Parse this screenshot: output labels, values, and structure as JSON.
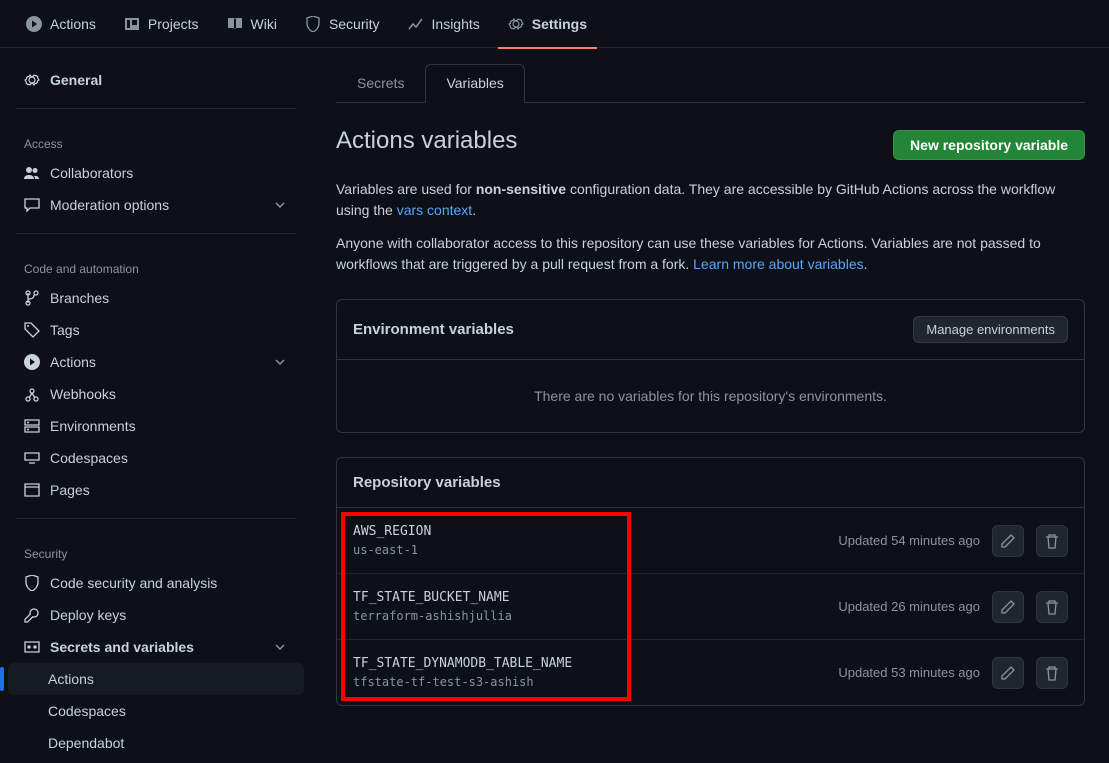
{
  "topnav": [
    {
      "icon": "play",
      "label": "Actions"
    },
    {
      "icon": "project",
      "label": "Projects"
    },
    {
      "icon": "book",
      "label": "Wiki"
    },
    {
      "icon": "shield",
      "label": "Security"
    },
    {
      "icon": "graph",
      "label": "Insights"
    },
    {
      "icon": "gear",
      "label": "Settings",
      "active": true
    }
  ],
  "sidebar": {
    "general": "General",
    "sections": [
      {
        "title": "Access",
        "items": [
          {
            "icon": "people",
            "label": "Collaborators"
          },
          {
            "icon": "comment",
            "label": "Moderation options",
            "chevron": true
          }
        ]
      },
      {
        "title": "Code and automation",
        "items": [
          {
            "icon": "branch",
            "label": "Branches"
          },
          {
            "icon": "tag",
            "label": "Tags"
          },
          {
            "icon": "play",
            "label": "Actions",
            "chevron": true
          },
          {
            "icon": "webhook",
            "label": "Webhooks"
          },
          {
            "icon": "server",
            "label": "Environments"
          },
          {
            "icon": "codespaces",
            "label": "Codespaces"
          },
          {
            "icon": "browser",
            "label": "Pages"
          }
        ]
      },
      {
        "title": "Security",
        "items": [
          {
            "icon": "shield",
            "label": "Code security and analysis"
          },
          {
            "icon": "key",
            "label": "Deploy keys"
          },
          {
            "icon": "keyasterisk",
            "label": "Secrets and variables",
            "chevron": true,
            "bold": true,
            "sub": [
              {
                "label": "Actions",
                "active": true
              },
              {
                "label": "Codespaces"
              },
              {
                "label": "Dependabot"
              }
            ]
          }
        ]
      }
    ]
  },
  "tabs": [
    {
      "label": "Secrets"
    },
    {
      "label": "Variables",
      "active": true
    }
  ],
  "page": {
    "title": "Actions variables",
    "primaryBtn": "New repository variable",
    "desc1_a": "Variables are used for ",
    "desc1_b": "non-sensitive",
    "desc1_c": " configuration data. They are accessible by GitHub Actions across the workflow using the ",
    "desc1_link": "vars context",
    "desc1_d": ".",
    "desc2_a": "Anyone with collaborator access to this repository can use these variables for Actions. Variables are not passed to workflows that are triggered by a pull request from a fork. ",
    "desc2_link": "Learn more about variables",
    "desc2_b": "."
  },
  "envPanel": {
    "title": "Environment variables",
    "button": "Manage environments",
    "empty": "There are no variables for this repository's environments."
  },
  "repoPanel": {
    "title": "Repository variables",
    "variables": [
      {
        "name": "AWS_REGION",
        "value": "us-east-1",
        "updated": "Updated 54 minutes ago"
      },
      {
        "name": "TF_STATE_BUCKET_NAME",
        "value": "terraform-ashishjullia",
        "updated": "Updated 26 minutes ago"
      },
      {
        "name": "TF_STATE_DYNAMODB_TABLE_NAME",
        "value": "tfstate-tf-test-s3-ashish",
        "updated": "Updated 53 minutes ago"
      }
    ]
  }
}
